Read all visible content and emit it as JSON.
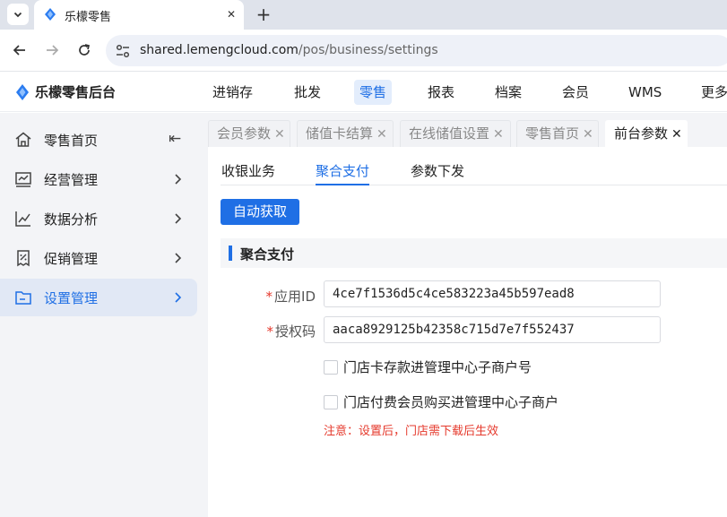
{
  "browser": {
    "tab_title": "乐檬零售",
    "close_glyph": "✕",
    "new_tab_glyph": "+",
    "url_host": "shared.lemengcloud.com",
    "url_path": "/pos/business/settings"
  },
  "app": {
    "logo_text": "乐檬零售后台",
    "top_nav": [
      "进销存",
      "批发",
      "零售",
      "报表",
      "档案",
      "会员",
      "WMS",
      "更多"
    ],
    "active_nav": "零售"
  },
  "sidebar": {
    "items": [
      {
        "label": "零售首页",
        "icon": "home-icon"
      },
      {
        "label": "经营管理",
        "icon": "chart-board-icon"
      },
      {
        "label": "数据分析",
        "icon": "line-chart-icon"
      },
      {
        "label": "促销管理",
        "icon": "promotion-icon"
      },
      {
        "label": "设置管理",
        "icon": "folder-icon"
      }
    ],
    "collapse_glyph": "⇤"
  },
  "page_tabs": [
    {
      "label": "会员参数",
      "close": "✕"
    },
    {
      "label": "储值卡结算",
      "close": "✕"
    },
    {
      "label": "在线储值设置",
      "close": "✕"
    },
    {
      "label": "零售首页",
      "close": "✕"
    },
    {
      "label": "前台参数",
      "close": "✕"
    }
  ],
  "sub_tabs": [
    "收银业务",
    "聚合支付",
    "参数下发"
  ],
  "auto_fetch_button": "自动获取",
  "section_title": "聚合支付",
  "form": {
    "required_mark": "*",
    "app_id_label": "应用ID",
    "app_id_value": "4ce7f1536d5c4ce583223a45b597ead8",
    "auth_code_label": "授权码",
    "auth_code_value": "aaca8929125b42358c715d7e7f552437",
    "checkbox_1": "门店卡存款进管理中心子商户号",
    "checkbox_2": "门店付费会员购买进管理中心子商户",
    "note": "注意：设置后，门店需下载后生效"
  },
  "colors": {
    "accent": "#1f6fe5",
    "danger": "#e5392c"
  }
}
